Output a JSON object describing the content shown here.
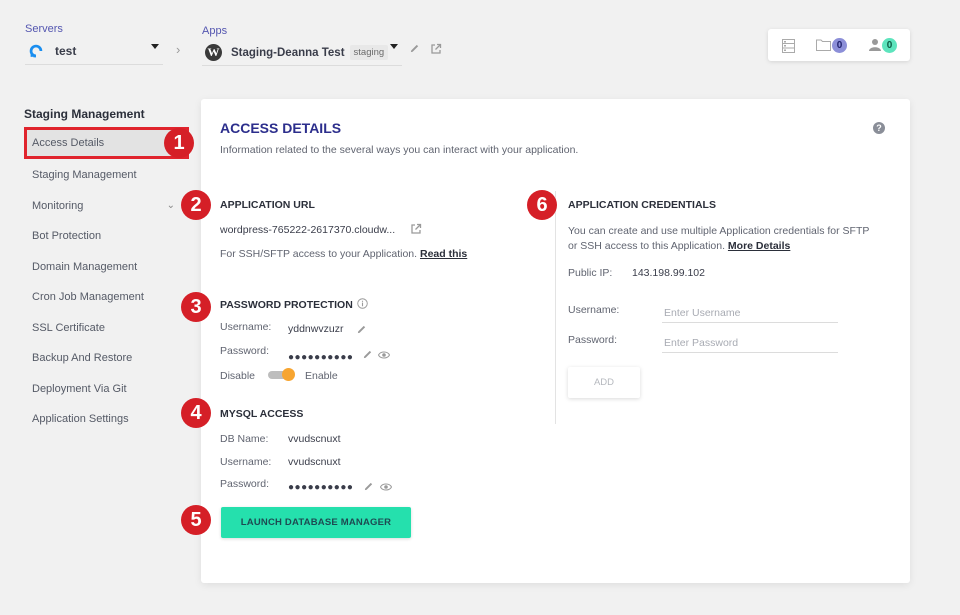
{
  "header": {
    "servers_label": "Servers",
    "server_name": "test",
    "apps_label": "Apps",
    "app_name": "Staging-Deanna Test",
    "app_badge": "staging",
    "breadcrumb_separator": "›",
    "widget": {
      "folder_count": "0",
      "user_count": "0"
    }
  },
  "sidebar": {
    "title": "Staging Management",
    "items": [
      {
        "label": "Access Details",
        "active": true
      },
      {
        "label": "Staging Management"
      },
      {
        "label": "Monitoring",
        "has_chevron": true
      },
      {
        "label": "Bot Protection"
      },
      {
        "label": "Domain Management"
      },
      {
        "label": "Cron Job Management"
      },
      {
        "label": "SSL Certificate"
      },
      {
        "label": "Backup And Restore"
      },
      {
        "label": "Deployment Via Git"
      },
      {
        "label": "Application Settings"
      }
    ]
  },
  "markers": [
    "1",
    "2",
    "3",
    "4",
    "5",
    "6"
  ],
  "card": {
    "title": "ACCESS DETAILS",
    "subtitle": "Information related to the several ways you can interact with your application.",
    "help_icon": "?",
    "app_url": {
      "title": "APPLICATION URL",
      "url": "wordpress-765222-2617370.cloudw...",
      "ssh_text": "For SSH/SFTP access to your Application.",
      "read_link": "Read this"
    },
    "password_protection": {
      "title": "PASSWORD PROTECTION",
      "username_label": "Username:",
      "username": "yddnwvzuzr",
      "password_label": "Password:",
      "password_mask": "●●●●●●●●●●",
      "disable_label": "Disable",
      "enable_label": "Enable",
      "enabled": true
    },
    "mysql": {
      "title": "MYSQL ACCESS",
      "db_name_label": "DB Name:",
      "db_name": "vvudscnuxt",
      "username_label": "Username:",
      "username": "vvudscnuxt",
      "password_label": "Password:",
      "password_mask": "●●●●●●●●●●",
      "launch_button": "LAUNCH DATABASE MANAGER"
    },
    "credentials": {
      "title": "APPLICATION CREDENTIALS",
      "desc_line1": "You can create and use multiple Application credentials for SFTP",
      "desc_line2": "or SSH access to this Application.",
      "more_link": "More Details",
      "public_ip_label": "Public IP:",
      "public_ip": "143.198.99.102",
      "username_label": "Username:",
      "username_placeholder": "Enter Username",
      "password_label": "Password:",
      "password_placeholder": "Enter Password",
      "add_button": "ADD"
    }
  }
}
